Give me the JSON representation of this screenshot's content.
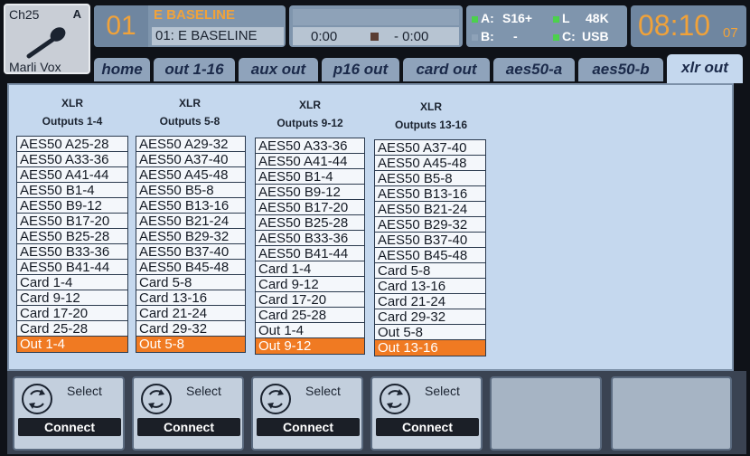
{
  "channel": {
    "id": "Ch25",
    "bank": "A",
    "name": "Marli Vox",
    "icon": "microphone-icon"
  },
  "scene": {
    "number": "01",
    "name": "E BASELINE",
    "subtitle": "01: E BASELINE"
  },
  "transport": {
    "elapsed": "0:00",
    "remaining": "- 0:00"
  },
  "cards": {
    "a_label": "A:",
    "a_value": "S16+",
    "b_label": "B:",
    "b_value": "-",
    "l_label": "L",
    "l_value": "48K",
    "c_label": "C:",
    "c_value": "USB"
  },
  "clock": {
    "time": "08:10",
    "seconds": "07"
  },
  "tabs": [
    {
      "label": "home"
    },
    {
      "label": "out 1-16"
    },
    {
      "label": "aux out"
    },
    {
      "label": "p16 out"
    },
    {
      "label": "card out"
    },
    {
      "label": "aes50-a"
    },
    {
      "label": "aes50-b"
    },
    {
      "label": "xlr out"
    }
  ],
  "active_tab": "xlr out",
  "columns": [
    {
      "title": "XLR",
      "subtitle": "Outputs 1-4",
      "items": [
        "AES50 A25-28",
        "AES50 A33-36",
        "AES50 A41-44",
        "AES50 B1-4",
        "AES50 B9-12",
        "AES50 B17-20",
        "AES50 B25-28",
        "AES50 B33-36",
        "AES50 B41-44",
        "Card 1-4",
        "Card 9-12",
        "Card 17-20",
        "Card 25-28",
        "Out 1-4"
      ],
      "selected": "Out 1-4"
    },
    {
      "title": "XLR",
      "subtitle": "Outputs 5-8",
      "items": [
        "AES50 A29-32",
        "AES50 A37-40",
        "AES50 A45-48",
        "AES50 B5-8",
        "AES50 B13-16",
        "AES50 B21-24",
        "AES50 B29-32",
        "AES50 B37-40",
        "AES50 B45-48",
        "Card 5-8",
        "Card 13-16",
        "Card 21-24",
        "Card 29-32",
        "Out 5-8"
      ],
      "selected": "Out 5-8"
    },
    {
      "title": "XLR",
      "subtitle": "Outputs 9-12",
      "items": [
        "AES50 A33-36",
        "AES50 A41-44",
        "AES50 B1-4",
        "AES50 B9-12",
        "AES50 B17-20",
        "AES50 B25-28",
        "AES50 B33-36",
        "AES50 B41-44",
        "Card 1-4",
        "Card 9-12",
        "Card 17-20",
        "Card 25-28",
        "Out 1-4",
        "Out 9-12"
      ],
      "selected": "Out 9-12"
    },
    {
      "title": "XLR",
      "subtitle": "Outputs 13-16",
      "items": [
        "AES50 A37-40",
        "AES50 A45-48",
        "AES50 B5-8",
        "AES50 B13-16",
        "AES50 B21-24",
        "AES50 B29-32",
        "AES50 B37-40",
        "AES50 B45-48",
        "Card 5-8",
        "Card 13-16",
        "Card 21-24",
        "Card 29-32",
        "Out 5-8",
        "Out 13-16"
      ],
      "selected": "Out 13-16"
    }
  ],
  "encoders": [
    {
      "select_label": "Select",
      "button_label": "Connect",
      "icon": "rotary-encoder-icon"
    },
    {
      "select_label": "Select",
      "button_label": "Connect",
      "icon": "rotary-encoder-icon"
    },
    {
      "select_label": "Select",
      "button_label": "Connect",
      "icon": "rotary-encoder-icon"
    },
    {
      "select_label": "Select",
      "button_label": "Connect",
      "icon": "rotary-encoder-icon"
    }
  ],
  "colors": {
    "accent_orange": "#f07a22",
    "clock_orange": "#f0a23a",
    "panel_blue": "#c5d8ee",
    "led_green": "#4cd14c"
  }
}
